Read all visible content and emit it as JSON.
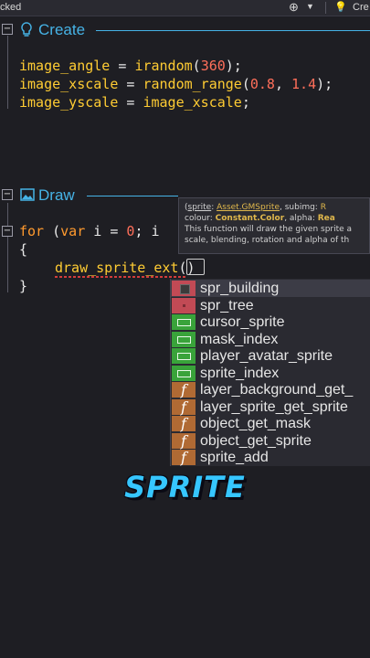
{
  "topbar": {
    "status": "cked",
    "create_button": "Cre"
  },
  "create_section": {
    "title": "Create"
  },
  "draw_section": {
    "title": "Draw"
  },
  "create_code": {
    "line1": {
      "var": "image_angle",
      "op": " = ",
      "fn": "irandom",
      "open": "(",
      "num": "360",
      "close": ");"
    },
    "line2": {
      "var": "image_xscale",
      "op": " = ",
      "fn": "random_range",
      "open": "(",
      "num1": "0.8",
      "comma": ", ",
      "num2": "1.4",
      "close": ");"
    },
    "line3": {
      "var": "image_yscale",
      "op": " = ",
      "rhs": "image_xscale",
      "end": ";"
    }
  },
  "draw_code": {
    "for_kw": "for",
    "paren": " (",
    "var_kw": "var",
    "iter": " i = ",
    "zero": "0",
    "rest": "; i",
    "open_brace": "{",
    "call": "draw_sprite_ext",
    "call_paren": "()",
    "close_brace": "}"
  },
  "tooltip": {
    "p1_name": "sprite",
    "p1_type": "Asset.GMSprite",
    "p2": ", subimg: ",
    "p2_type": "R",
    "p3_name": "colour",
    "p3_type": "Constant.Color",
    "p4": ", alpha: ",
    "p4_type": "Rea",
    "desc1": "This function will draw the given sprite a",
    "desc2": "scale, blending, rotation and alpha of th"
  },
  "autocomplete": {
    "items": [
      {
        "label": "spr_building",
        "kind": "sprite",
        "selected": true
      },
      {
        "label": "spr_tree",
        "kind": "sprite",
        "selected": false
      },
      {
        "label": "cursor_sprite",
        "kind": "variable",
        "selected": false
      },
      {
        "label": "mask_index",
        "kind": "variable",
        "selected": false
      },
      {
        "label": "player_avatar_sprite",
        "kind": "variable",
        "selected": false
      },
      {
        "label": "sprite_index",
        "kind": "variable",
        "selected": false
      },
      {
        "label": "layer_background_get_",
        "kind": "function",
        "selected": false
      },
      {
        "label": "layer_sprite_get_sprite",
        "kind": "function",
        "selected": false
      },
      {
        "label": "object_get_mask",
        "kind": "function",
        "selected": false
      },
      {
        "label": "object_get_sprite",
        "kind": "function",
        "selected": false
      },
      {
        "label": "sprite_add",
        "kind": "function",
        "selected": false
      }
    ],
    "function_glyph": "f"
  },
  "caption": "SPRITE",
  "colors": {
    "accent": "#46b3e6",
    "variable": "#ffcc33",
    "keyword": "#ff9a2e",
    "number": "#ff6f5a",
    "sprite_badge": "#c14a55",
    "variable_badge": "#39a33a",
    "function_badge": "#b06a34",
    "caption": "#36c6ff"
  }
}
